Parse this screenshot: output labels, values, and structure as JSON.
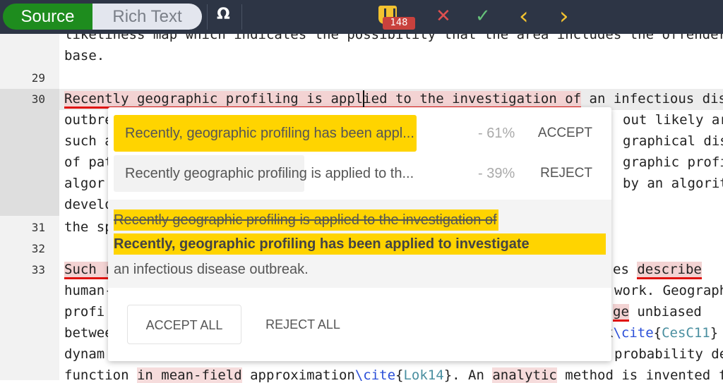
{
  "toolbar": {
    "source": "Source",
    "rich_text": "Rich Text",
    "omega": "Ω",
    "badge": "148",
    "icons": [
      "logo-icon",
      "close-icon",
      "check-icon",
      "chevron-left-icon",
      "chevron-right-icon"
    ],
    "reject": "✕",
    "accept": "✓",
    "prev": "‹",
    "next": "›"
  },
  "gutter": {
    "l29": "29",
    "l30": "30",
    "l31": "31",
    "l32": "32",
    "l33": "33"
  },
  "editor": {
    "top": "likeliness map which indicates the possibility that the area includes the offender",
    "base": "base.",
    "l30a": "Recently geographic profiling is applied to the investigation of",
    "l30b": " an infectious dis",
    "w1a": "outbre",
    "w1b": "out likely are",
    "w2a": "such a",
    "w2b": "graphical dist",
    "w3a": "of pat",
    "w3b": "graphic profil",
    "w4a": "algor",
    "w4b": "by an algorit",
    "w5a": "develo",
    "l31": "the sp",
    "l33a": "Such r",
    "l33b": "es ",
    "l33c": "describe",
    "w6a": "human-",
    "w6b": "work. Geograph",
    "w7a": "profi",
    "w7b": "ge",
    "w7c": " unbiased",
    "w8a": "betwee",
    "w8b": "k",
    "w8c": "\\cite",
    "w8d": "{",
    "w8e": "CesC11",
    "w8f": "}",
    "w9a": "dynam",
    "w9b": "probability der",
    "last1": "function ",
    "last2": "in mean-field",
    "last3": " approximation",
    "last4": "\\cite",
    "last5": "{",
    "last6": "Lok14",
    "last7": "}. An ",
    "last8": "analytic",
    "last9": " method is invented f"
  },
  "popup": {
    "options": [
      {
        "text": "Recently, geographic profiling has been appl...",
        "percent": "- 61%",
        "action": "ACCEPT",
        "score": 61
      },
      {
        "text": "Recently geographic profiling is applied to th...",
        "percent": "- 39%",
        "action": "REJECT",
        "score": 39
      }
    ],
    "diff_removed": "Recently geographic profiling is applied to the investigation of",
    "diff_added": "Recently, geographic profiling has been applied to investigate",
    "diff_rest": "an infectious disease outbreak.",
    "accept_all": "ACCEPT ALL",
    "reject_all": "REJECT ALL"
  },
  "colors": {
    "toolbar": "#2d3545",
    "source_active": "#1e8c1e",
    "highlight": "#ffd400",
    "error": "#e0120f"
  }
}
